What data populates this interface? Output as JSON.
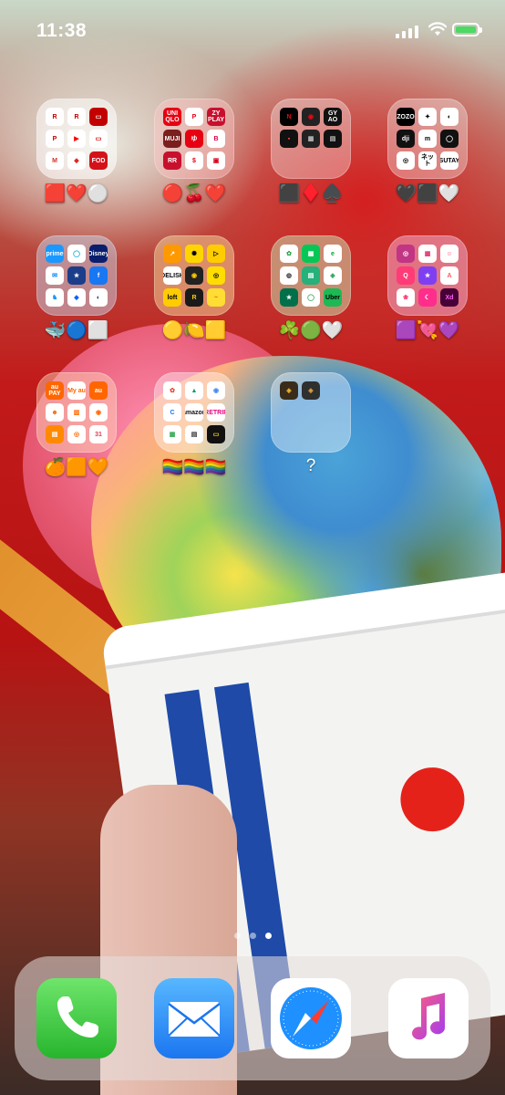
{
  "status_bar": {
    "time": "11:38"
  },
  "folders": [
    {
      "id": "f1",
      "label": "🟥❤️⚪",
      "tint": "rgba(255,255,255,0.55)",
      "apps": [
        {
          "text": "R",
          "bg": "#ffffff",
          "fg": "#c30000"
        },
        {
          "text": "R",
          "bg": "#ffffff",
          "fg": "#c30000"
        },
        {
          "text": "▭",
          "bg": "#c30000",
          "fg": "#ffffff"
        },
        {
          "text": "P",
          "bg": "#ffffff",
          "fg": "#c30000"
        },
        {
          "text": "▶",
          "bg": "#ffffff",
          "fg": "#ff0000"
        },
        {
          "text": "▭",
          "bg": "#ffffff",
          "fg": "#c30000"
        },
        {
          "text": "M",
          "bg": "#ffffff",
          "fg": "#d93025"
        },
        {
          "text": "◆",
          "bg": "#ffffff",
          "fg": "#e0261f"
        },
        {
          "text": "FOD",
          "bg": "#d5121a",
          "fg": "#ffffff"
        }
      ]
    },
    {
      "id": "f2",
      "label": "🔴🍒❤️",
      "tint": "rgba(255,200,200,0.45)",
      "apps": [
        {
          "text": "UNI QLO",
          "bg": "#e60012",
          "fg": "#ffffff"
        },
        {
          "text": "P",
          "bg": "#ffffff",
          "fg": "#e60012"
        },
        {
          "text": "ZY PLAY",
          "bg": "#c8102e",
          "fg": "#ffffff"
        },
        {
          "text": "MUJI",
          "bg": "#7a1e1e",
          "fg": "#ffffff"
        },
        {
          "text": "ゆ",
          "bg": "#e60012",
          "fg": "#ffffff"
        },
        {
          "text": "B",
          "bg": "#ffffff",
          "fg": "#e0004d"
        },
        {
          "text": "RR",
          "bg": "#c8102e",
          "fg": "#ffffff"
        },
        {
          "text": "$",
          "bg": "#ffffff",
          "fg": "#e60012"
        },
        {
          "text": "▣",
          "bg": "#ffffff",
          "fg": "#d9001b"
        }
      ]
    },
    {
      "id": "f3",
      "label": "⬛♦️♠️",
      "tint": "rgba(255,255,255,0.35)",
      "apps": [
        {
          "text": "N",
          "bg": "#000000",
          "fg": "#e50914"
        },
        {
          "text": "◉",
          "bg": "#222222",
          "fg": "#e50914"
        },
        {
          "text": "GY AO",
          "bg": "#111111",
          "fg": "#ffffff"
        },
        {
          "text": "▪",
          "bg": "#111111",
          "fg": "#ff4040"
        },
        {
          "text": "▦",
          "bg": "#222222",
          "fg": "#bbbbbb"
        },
        {
          "text": "▤",
          "bg": "#111111",
          "fg": "#bbbbbb"
        },
        {
          "text": "",
          "bg": "transparent",
          "fg": "#ffffff"
        },
        {
          "text": "",
          "bg": "transparent",
          "fg": "#ffffff"
        },
        {
          "text": "",
          "bg": "transparent",
          "fg": "#ffffff"
        }
      ]
    },
    {
      "id": "f4",
      "label": "🖤⬛🤍",
      "tint": "rgba(255,255,255,0.35)",
      "apps": [
        {
          "text": "ZOZO",
          "bg": "#000000",
          "fg": "#ffffff"
        },
        {
          "text": "✦",
          "bg": "#ffffff",
          "fg": "#000000"
        },
        {
          "text": "◐",
          "bg": "#ffffff",
          "fg": "#000000"
        },
        {
          "text": "dji",
          "bg": "#111111",
          "fg": "#ffffff"
        },
        {
          "text": "m",
          "bg": "#ffffff",
          "fg": "#000000"
        },
        {
          "text": "◯",
          "bg": "#111111",
          "fg": "#ffffff"
        },
        {
          "text": "◎",
          "bg": "#ffffff",
          "fg": "#000000"
        },
        {
          "text": "ネット",
          "bg": "#ffffff",
          "fg": "#000000"
        },
        {
          "text": "TSUTAYA",
          "bg": "#ffffff",
          "fg": "#000000"
        }
      ]
    },
    {
      "id": "f5",
      "label": "🐳🔵⬜",
      "tint": "rgba(200,230,255,0.45)",
      "apps": [
        {
          "text": "prime",
          "bg": "#1a98ff",
          "fg": "#ffffff"
        },
        {
          "text": "◯",
          "bg": "#ffffff",
          "fg": "#00a8e1"
        },
        {
          "text": "Disney",
          "bg": "#0a1e6e",
          "fg": "#ffffff"
        },
        {
          "text": "✉",
          "bg": "#ffffff",
          "fg": "#0084ff"
        },
        {
          "text": "★",
          "bg": "#1c3d8a",
          "fg": "#ffffff"
        },
        {
          "text": "f",
          "bg": "#1877f2",
          "fg": "#ffffff"
        },
        {
          "text": "♞",
          "bg": "#ffffff",
          "fg": "#1d9bf0"
        },
        {
          "text": "◆",
          "bg": "#ffffff",
          "fg": "#0061fe"
        },
        {
          "text": "◐",
          "bg": "#ffffff",
          "fg": "#1b3a6b"
        }
      ]
    },
    {
      "id": "f6",
      "label": "🟡🍋🟨",
      "tint": "rgba(255,240,170,0.45)",
      "apps": [
        {
          "text": "↗",
          "bg": "#ff9900",
          "fg": "#ffffff"
        },
        {
          "text": "✺",
          "bg": "#ffd500",
          "fg": "#000000"
        },
        {
          "text": "▷",
          "bg": "#ffcc00",
          "fg": "#000000"
        },
        {
          "text": "DELISH",
          "bg": "#ffffff",
          "fg": "#000000"
        },
        {
          "text": "◉",
          "bg": "#222222",
          "fg": "#ffcc00"
        },
        {
          "text": "◎",
          "bg": "#ffdd00",
          "fg": "#000000"
        },
        {
          "text": "loft",
          "bg": "#ffcc00",
          "fg": "#000000"
        },
        {
          "text": "R",
          "bg": "#1a1a1a",
          "fg": "#ffcc00"
        },
        {
          "text": "~",
          "bg": "#ffdd33",
          "fg": "#e65c00"
        }
      ]
    },
    {
      "id": "f7",
      "label": "☘️🟢🤍",
      "tint": "rgba(200,255,200,0.45)",
      "apps": [
        {
          "text": "✿",
          "bg": "#ffffff",
          "fg": "#2ea44f"
        },
        {
          "text": "▦",
          "bg": "#06c755",
          "fg": "#ffffff"
        },
        {
          "text": "e",
          "bg": "#ffffff",
          "fg": "#00a82d"
        },
        {
          "text": "◍",
          "bg": "#ffffff",
          "fg": "#3a3a3a"
        },
        {
          "text": "▤",
          "bg": "#26b07a",
          "fg": "#ffffff"
        },
        {
          "text": "◈",
          "bg": "#ffffff",
          "fg": "#2fa360"
        },
        {
          "text": "★",
          "bg": "#00704a",
          "fg": "#ffffff"
        },
        {
          "text": "◯",
          "bg": "#ffffff",
          "fg": "#2ea44f"
        },
        {
          "text": "Uber",
          "bg": "#1db954",
          "fg": "#000000"
        }
      ]
    },
    {
      "id": "f8",
      "label": "🟪💘💜",
      "tint": "rgba(255,200,240,0.45)",
      "apps": [
        {
          "text": "◎",
          "bg": "#c13584",
          "fg": "#ffffff"
        },
        {
          "text": "▦",
          "bg": "#ffffff",
          "fg": "#e1306c"
        },
        {
          "text": "☺",
          "bg": "#ffffff",
          "fg": "#ff3b6b"
        },
        {
          "text": "Q",
          "bg": "#ff3c78",
          "fg": "#ffffff"
        },
        {
          "text": "★",
          "bg": "#7e3ff2",
          "fg": "#ffffff"
        },
        {
          "text": "A",
          "bg": "#ffffff",
          "fg": "#ff5a5f"
        },
        {
          "text": "❀",
          "bg": "#ffffff",
          "fg": "#ff2d6f"
        },
        {
          "text": "☾",
          "bg": "#ff2d8c",
          "fg": "#ffffff"
        },
        {
          "text": "Xd",
          "bg": "#470137",
          "fg": "#ff61f6"
        }
      ]
    },
    {
      "id": "f9",
      "label": "🍊🟧🧡",
      "tint": "rgba(255,225,190,0.45)",
      "apps": [
        {
          "text": "au PAY",
          "bg": "#ff6600",
          "fg": "#ffffff"
        },
        {
          "text": "My au",
          "bg": "#ffffff",
          "fg": "#ff6600"
        },
        {
          "text": "au",
          "bg": "#ff6600",
          "fg": "#ffffff"
        },
        {
          "text": "☻",
          "bg": "#ffffff",
          "fg": "#ff6600"
        },
        {
          "text": "▥",
          "bg": "#ffffff",
          "fg": "#ff6600"
        },
        {
          "text": "◉",
          "bg": "#ffffff",
          "fg": "#ff6600"
        },
        {
          "text": "▤",
          "bg": "#ff8a00",
          "fg": "#ffffff"
        },
        {
          "text": "◎",
          "bg": "#ffffff",
          "fg": "#ff6600"
        },
        {
          "text": "31",
          "bg": "#ffffff",
          "fg": "#e23b57"
        }
      ]
    },
    {
      "id": "f10",
      "label": "🏳️‍🌈🏳️‍🌈🏳️‍🌈",
      "tint": "rgba(255,255,255,0.4)",
      "apps": [
        {
          "text": "✿",
          "bg": "#ffffff",
          "fg": "#ea4335"
        },
        {
          "text": "▲",
          "bg": "#ffffff",
          "fg": "#0f9d58"
        },
        {
          "text": "◉",
          "bg": "#ffffff",
          "fg": "#4285f4"
        },
        {
          "text": "C",
          "bg": "#ffffff",
          "fg": "#1a73e8"
        },
        {
          "text": "amazon",
          "bg": "#ffffff",
          "fg": "#111111"
        },
        {
          "text": "RETRIP",
          "bg": "#ffffff",
          "fg": "#e3007f"
        },
        {
          "text": "▦",
          "bg": "#ffffff",
          "fg": "#34a853"
        },
        {
          "text": "▤",
          "bg": "#ffffff",
          "fg": "#333333"
        },
        {
          "text": "▭",
          "bg": "#111111",
          "fg": "#ffd700"
        }
      ]
    },
    {
      "id": "f11",
      "label": "?",
      "tint": "rgba(255,255,255,0.4)",
      "apps": [
        {
          "text": "◈",
          "bg": "#3a2c1a",
          "fg": "#f0b030"
        },
        {
          "text": "◈",
          "bg": "#2f2f2f",
          "fg": "#d9a040"
        },
        {
          "text": "",
          "bg": "transparent",
          "fg": "#ffffff"
        },
        {
          "text": "",
          "bg": "transparent",
          "fg": "#ffffff"
        },
        {
          "text": "",
          "bg": "transparent",
          "fg": "#ffffff"
        },
        {
          "text": "",
          "bg": "transparent",
          "fg": "#ffffff"
        },
        {
          "text": "",
          "bg": "transparent",
          "fg": "#ffffff"
        },
        {
          "text": "",
          "bg": "transparent",
          "fg": "#ffffff"
        },
        {
          "text": "",
          "bg": "transparent",
          "fg": "#ffffff"
        }
      ]
    }
  ],
  "page_indicator": {
    "pages": 3,
    "current": 3
  },
  "dock": [
    {
      "name": "phone",
      "icon": "phone-icon"
    },
    {
      "name": "mail",
      "icon": "mail-icon"
    },
    {
      "name": "safari",
      "icon": "compass-icon"
    },
    {
      "name": "music",
      "icon": "music-note-icon"
    }
  ]
}
